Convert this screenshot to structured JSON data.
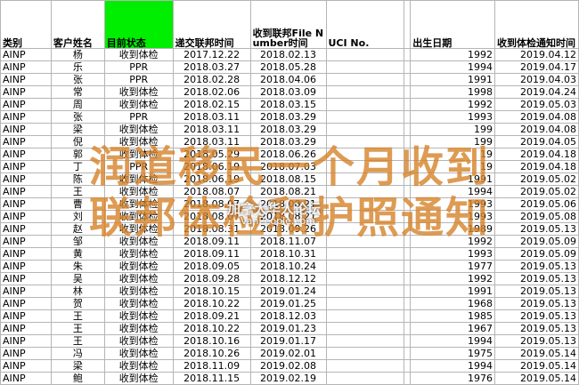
{
  "headers": [
    "类别",
    "客户姓名",
    "目前状态",
    "递交联邦时间",
    "收到联邦File Number时间",
    "UCI No.",
    "",
    "出生日期",
    "收到体检通知时间"
  ],
  "rows": [
    [
      "AINP",
      "杨",
      "收到体检",
      "2017.12.22",
      "2018.02.13",
      "",
      "",
      "1992",
      "2019.04.12"
    ],
    [
      "AINP",
      "乐",
      "PPR",
      "2018.03.27",
      "2018.05.28",
      "",
      "",
      "1994",
      "2019.04.17"
    ],
    [
      "AINP",
      "张",
      "PPR",
      "2018.02.28",
      "2018.04.06",
      "",
      "",
      "1991",
      "2019.04.03"
    ],
    [
      "AINP",
      "常",
      "收到体检",
      "2018.02.06",
      "2018.03.09",
      "",
      "",
      "1998",
      "2019.04.24"
    ],
    [
      "AINP",
      "周",
      "收到体检",
      "2018.02.15",
      "2018.03.15",
      "",
      "",
      "1992",
      "2019.05.03"
    ],
    [
      "AINP",
      "张",
      "PPR",
      "2018.03.11",
      "2018.03.29",
      "",
      "",
      "1993",
      "2019.04.08"
    ],
    [
      "AINP",
      "梁",
      "收到体检",
      "2018.03.11",
      "2018.03.29",
      "",
      "",
      "199",
      "2019.04.08"
    ],
    [
      "AINP",
      "倪",
      "收到体检",
      "2018.03.11",
      "2018.03.29",
      "",
      "",
      "199",
      "2019.04.05"
    ],
    [
      "AINP",
      "郭",
      "收到体检",
      "2018.05.29",
      "2018.06.26",
      "",
      "",
      "19",
      "2019.04.18"
    ],
    [
      "AINP",
      "丁",
      "PPR",
      "2018.06.19",
      "2018.07.03",
      "",
      "",
      "19",
      "2019.04.18"
    ],
    [
      "AINP",
      "陈",
      "收到体检",
      "2018.06.19",
      "2018.08.15",
      "",
      "",
      "1991",
      "2019.05.02"
    ],
    [
      "AINP",
      "王",
      "收到体检",
      "2018.08.07",
      "2018.08.21",
      "",
      "",
      "1994",
      "2019.05.02"
    ],
    [
      "AINP",
      "曹",
      "收到体检",
      "2018.08.07",
      "2018.08.21",
      "",
      "",
      "1993",
      "2019.05.06"
    ],
    [
      "AINP",
      "刘",
      "收到体检",
      "2018.08.07",
      "2018.08.21",
      "",
      "",
      "1993",
      "2019.05.08"
    ],
    [
      "AINP",
      "赵",
      "收到体检",
      "2018.08.31",
      "2018.09.26",
      "",
      "",
      "1989",
      "2019.05.13"
    ],
    [
      "AINP",
      "邹",
      "收到体检",
      "2018.09.11",
      "2018.11.07",
      "",
      "",
      "1992",
      "2019.05.09"
    ],
    [
      "AINP",
      "黄",
      "收到体检",
      "2018.09.11",
      "2018.10.31",
      "",
      "",
      "1993",
      "2019.05.09"
    ],
    [
      "AINP",
      "朱",
      "收到体检",
      "2018.09.05",
      "2018.10.24",
      "",
      "",
      "1977",
      "2019.05.13"
    ],
    [
      "AINP",
      "吴",
      "收到体检",
      "2018.09.28",
      "2018.12.12",
      "",
      "",
      "1992",
      "2019.05.13"
    ],
    [
      "AINP",
      "林",
      "收到体检",
      "2018.10.15",
      "2019.01.24",
      "",
      "",
      "1991",
      "2019.05.13"
    ],
    [
      "AINP",
      "贺",
      "收到体检",
      "2018.10.22",
      "2019.01.25",
      "",
      "",
      "1968",
      "2019.05.13"
    ],
    [
      "AINP",
      "王",
      "收到体检",
      "2018.09.21",
      "2018.12.03",
      "",
      "",
      "1985",
      "2019.05.13"
    ],
    [
      "AINP",
      "王",
      "收到体检",
      "2018.10.22",
      "2019.01.23",
      "",
      "",
      "1967",
      "2019.05.13"
    ],
    [
      "AINP",
      "王",
      "收到体检",
      "2018.10.16",
      "2019.01.17",
      "",
      "",
      "1994",
      "2019.05.13"
    ],
    [
      "AINP",
      "冯",
      "收到体检",
      "2018.10.26",
      "2019.02.01",
      "",
      "",
      "1975",
      "2019.05.14"
    ],
    [
      "AINP",
      "梁",
      "收到体检",
      "2018.11.09",
      "2019.02.08",
      "",
      "",
      "1994",
      "2019.05.14"
    ],
    [
      "AINP",
      "鲍",
      "收到体检",
      "2018.11.15",
      "2019.02.19",
      "",
      "",
      "1976",
      "2019.05.14"
    ]
  ],
  "overlay": {
    "line1": "润道移民一个月收到",
    "line2": "联邦体检和护照通知"
  },
  "watermark": {
    "cn": "加拿大华人论坛",
    "en": "VanPeople.com"
  },
  "colors": {
    "status_header_bg": "#00ee00",
    "overlay_text": "#d68228"
  }
}
